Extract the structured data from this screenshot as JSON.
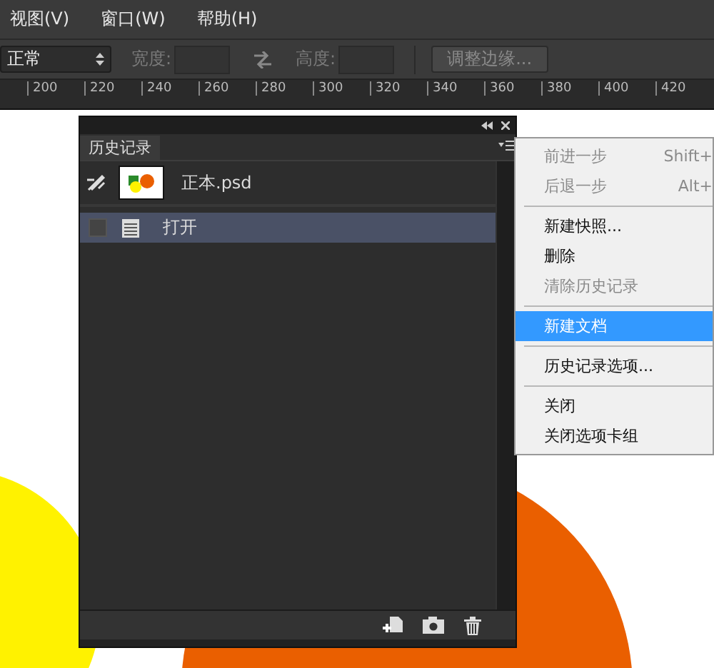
{
  "menu_bar": [
    "视图(V)",
    "窗口(W)",
    "帮助(H)"
  ],
  "options_bar": {
    "style": "正常",
    "width_label": "宽度:",
    "height_label": "高度:",
    "refine_button": "调整边缘..."
  },
  "ruler": [
    "200",
    "220",
    "240",
    "260",
    "280",
    "300",
    "320",
    "340",
    "360",
    "380",
    "400",
    "420"
  ],
  "history_panel": {
    "tab": "历史记录",
    "snapshot": {
      "name": "正本.psd"
    },
    "states": [
      {
        "name": "打开",
        "selected": true
      }
    ]
  },
  "context_menu": [
    {
      "kind": "item",
      "label": "前进一步",
      "shortcut": "Shift+",
      "disabled": true,
      "selected": false
    },
    {
      "kind": "item",
      "label": "后退一步",
      "shortcut": "Alt+",
      "disabled": true,
      "selected": false
    },
    {
      "kind": "separator"
    },
    {
      "kind": "item",
      "label": "新建快照...",
      "disabled": false,
      "selected": false
    },
    {
      "kind": "item",
      "label": "删除",
      "disabled": false,
      "selected": false
    },
    {
      "kind": "item",
      "label": "清除历史记录",
      "disabled": true,
      "selected": false
    },
    {
      "kind": "separator"
    },
    {
      "kind": "item",
      "label": "新建文档",
      "disabled": false,
      "selected": true
    },
    {
      "kind": "separator"
    },
    {
      "kind": "item",
      "label": "历史记录选项...",
      "disabled": false,
      "selected": false
    },
    {
      "kind": "separator"
    },
    {
      "kind": "item",
      "label": "关闭",
      "disabled": false,
      "selected": false
    },
    {
      "kind": "item",
      "label": "关闭选项卡组",
      "disabled": false,
      "selected": false
    }
  ]
}
